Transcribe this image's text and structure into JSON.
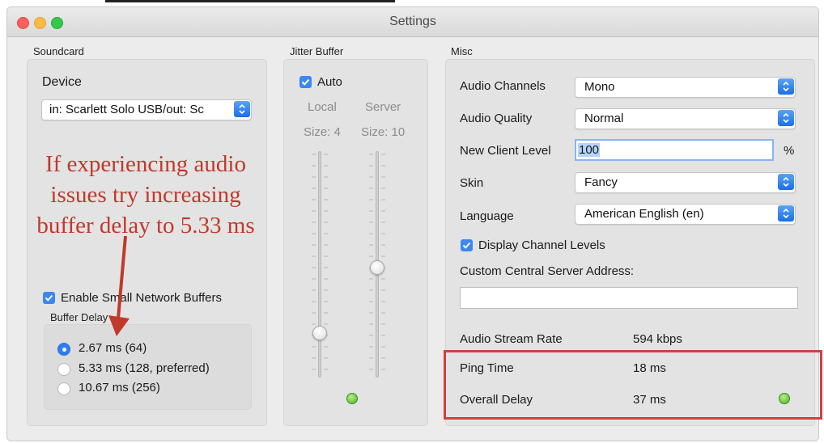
{
  "window": {
    "title": "Settings"
  },
  "soundcard": {
    "group_label": "Soundcard",
    "device_label": "Device",
    "device_value": "in: Scarlett Solo USB/out: Sc",
    "small_buffers_label": "Enable Small Network Buffers",
    "small_buffers_checked": true,
    "buffer_delay_label": "Buffer Delay",
    "buffer_options": [
      {
        "label": "2.67 ms (64)",
        "selected": true
      },
      {
        "label": "5.33 ms (128, preferred)",
        "selected": false
      },
      {
        "label": "10.67 ms (256)",
        "selected": false
      }
    ]
  },
  "jitter": {
    "group_label": "Jitter Buffer",
    "auto_label": "Auto",
    "auto_checked": true,
    "local_label": "Local",
    "server_label": "Server",
    "local_size": "Size: 4",
    "server_size": "Size: 10"
  },
  "misc": {
    "group_label": "Misc",
    "audio_channels_label": "Audio Channels",
    "audio_channels_value": "Mono",
    "audio_quality_label": "Audio Quality",
    "audio_quality_value": "Normal",
    "new_client_level_label": "New Client Level",
    "new_client_level_value": "100",
    "percent_sign": "%",
    "skin_label": "Skin",
    "skin_value": "Fancy",
    "language_label": "Language",
    "language_value": "American English (en)",
    "display_levels_label": "Display Channel Levels",
    "display_levels_checked": true,
    "central_server_label": "Custom Central Server Address:",
    "central_server_value": "",
    "audio_stream_rate_label": "Audio Stream Rate",
    "audio_stream_rate_value": "594 kbps",
    "ping_time_label": "Ping Time",
    "ping_time_value": "18 ms",
    "overall_delay_label": "Overall Delay",
    "overall_delay_value": "37 ms"
  },
  "annotation": {
    "line1": "If experiencing audio",
    "line2": "issues try increasing",
    "line3": "buffer delay to 5.33 ms",
    "color": "#c0392b"
  },
  "colors": {
    "accent": "#2f7df0",
    "led_green": "#4fae22",
    "highlight_box": "#d24040"
  }
}
